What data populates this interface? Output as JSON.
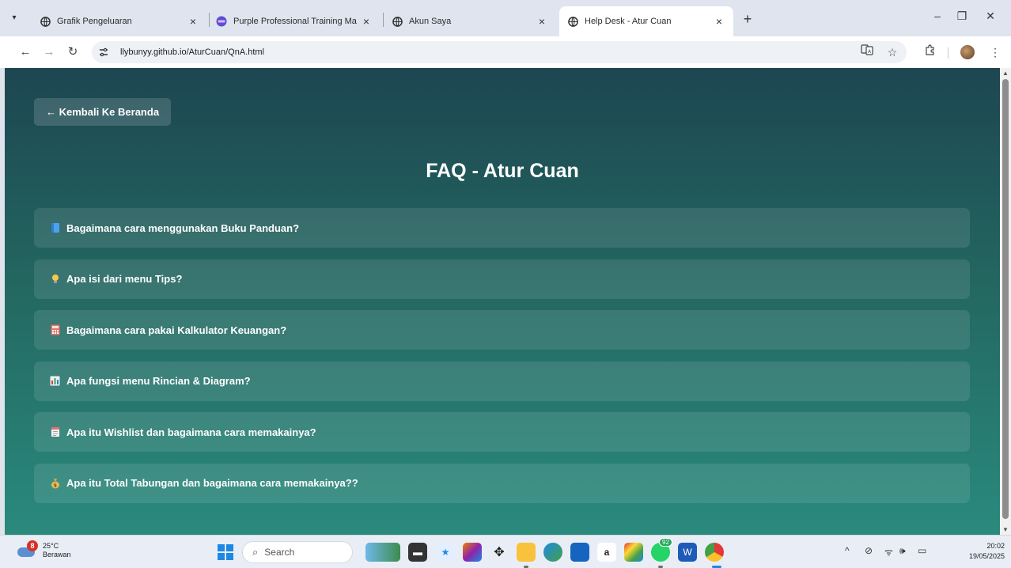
{
  "browser": {
    "tabs": [
      {
        "title": "Grafik Pengeluaran",
        "active": false
      },
      {
        "title": "Purple Professional Training Ma",
        "active": false
      },
      {
        "title": "Akun Saya",
        "active": false
      },
      {
        "title": "Help Desk - Atur Cuan",
        "active": true
      }
    ],
    "url": "llybunyy.github.io/AturCuan/QnA.html"
  },
  "page": {
    "back_label": "← Kembali Ke Beranda",
    "title": "FAQ - Atur Cuan",
    "faq": [
      {
        "icon": "book-icon",
        "question": "Bagaimana cara menggunakan Buku Panduan?"
      },
      {
        "icon": "lightbulb-icon",
        "question": "Apa isi dari menu Tips?"
      },
      {
        "icon": "calculator-icon",
        "question": "Bagaimana cara pakai Kalkulator Keuangan?"
      },
      {
        "icon": "bar-chart-icon",
        "question": "Apa fungsi menu Rincian & Diagram?"
      },
      {
        "icon": "wishlist-icon",
        "question": "Apa itu Wishlist dan bagaimana cara memakainya?"
      },
      {
        "icon": "money-bag-icon",
        "question": "Apa itu Total Tabungan dan bagaimana cara memakainya??"
      }
    ],
    "colors": {
      "gradient_top": "#1d4651",
      "gradient_bottom": "#2a8a7d"
    }
  },
  "taskbar": {
    "weather_badge": "8",
    "weather_temp": "25°C",
    "weather_desc": "Berawan",
    "search_placeholder": "Search",
    "whatsapp_badge": "92",
    "time": "20:02",
    "date": "19/05/2025"
  }
}
